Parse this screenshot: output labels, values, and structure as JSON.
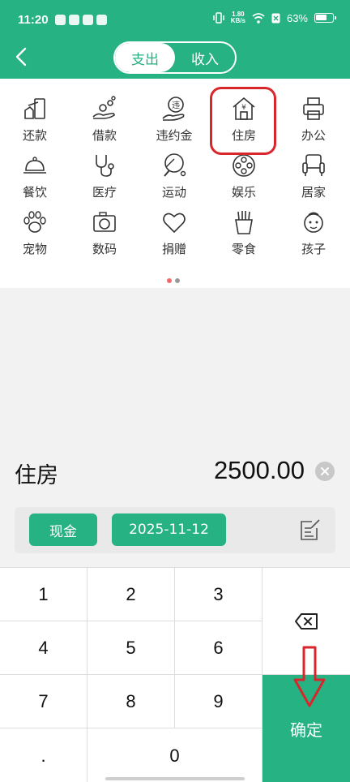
{
  "status": {
    "time": "11:20",
    "net_speed": "1.80",
    "net_unit": "KB/s",
    "battery": "63%"
  },
  "header": {
    "tabs": [
      {
        "label": "支出",
        "active": true
      },
      {
        "label": "收入",
        "active": false
      }
    ]
  },
  "categories": [
    {
      "label": "还款",
      "icon": "repay-icon"
    },
    {
      "label": "借款",
      "icon": "borrow-icon"
    },
    {
      "label": "违约金",
      "icon": "penalty-icon",
      "icon_text": "违"
    },
    {
      "label": "住房",
      "icon": "house-icon",
      "icon_text": "¥",
      "selected": true
    },
    {
      "label": "办公",
      "icon": "printer-icon"
    },
    {
      "label": "餐饮",
      "icon": "dining-cloche-icon"
    },
    {
      "label": "医疗",
      "icon": "stethoscope-icon"
    },
    {
      "label": "运动",
      "icon": "pingpong-icon"
    },
    {
      "label": "娱乐",
      "icon": "film-reel-icon"
    },
    {
      "label": "居家",
      "icon": "armchair-icon"
    },
    {
      "label": "宠物",
      "icon": "paw-icon"
    },
    {
      "label": "数码",
      "icon": "camera-icon"
    },
    {
      "label": "捐赠",
      "icon": "heart-icon"
    },
    {
      "label": "零食",
      "icon": "fries-icon"
    },
    {
      "label": "孩子",
      "icon": "baby-face-icon"
    }
  ],
  "entry": {
    "category": "住房",
    "amount": "2500.00"
  },
  "options": {
    "account": "现金",
    "date": "2025-11-12"
  },
  "keypad": {
    "keys": [
      "1",
      "2",
      "3",
      "4",
      "5",
      "6",
      "7",
      "8",
      "9",
      ".",
      "0"
    ],
    "confirm": "确定"
  },
  "colors": {
    "accent": "#26b283",
    "highlight": "#d9262c"
  }
}
